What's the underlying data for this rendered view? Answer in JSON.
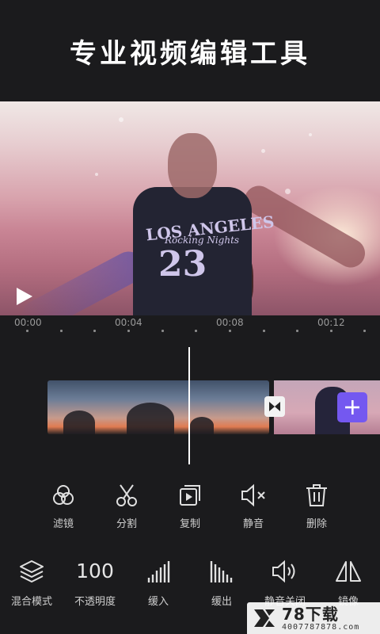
{
  "headline": "专业视频编辑工具",
  "preview": {
    "shirt_line1": "LOS ANGELES",
    "shirt_line2": "Rocking Nights",
    "shirt_number": "23",
    "play_icon": "play-icon"
  },
  "ruler": {
    "labels": [
      "00:00",
      "00:04",
      "00:08",
      "00:12"
    ]
  },
  "timeline": {
    "transition_icon": "transition-icon",
    "add_icon": "plus-icon"
  },
  "toolbar_primary": [
    {
      "label": "滤镜",
      "icon": "filter-icon"
    },
    {
      "label": "分割",
      "icon": "scissors-icon"
    },
    {
      "label": "复制",
      "icon": "copy-icon"
    },
    {
      "label": "静音",
      "icon": "mute-icon"
    },
    {
      "label": "删除",
      "icon": "trash-icon"
    }
  ],
  "toolbar_secondary": [
    {
      "label": "混合模式",
      "icon": "layers-icon"
    },
    {
      "label": "不透明度",
      "value": "100"
    },
    {
      "label": "缓入",
      "icon": "fade-in-icon"
    },
    {
      "label": "缓出",
      "icon": "fade-out-icon"
    },
    {
      "label": "静音关闭",
      "icon": "volume-icon"
    },
    {
      "label": "镜像",
      "icon": "mirror-icon"
    }
  ],
  "watermark": {
    "title": "78下载",
    "url": "4007787878.com"
  },
  "colors": {
    "background": "#1b1b1d",
    "accent": "#7458f0"
  }
}
